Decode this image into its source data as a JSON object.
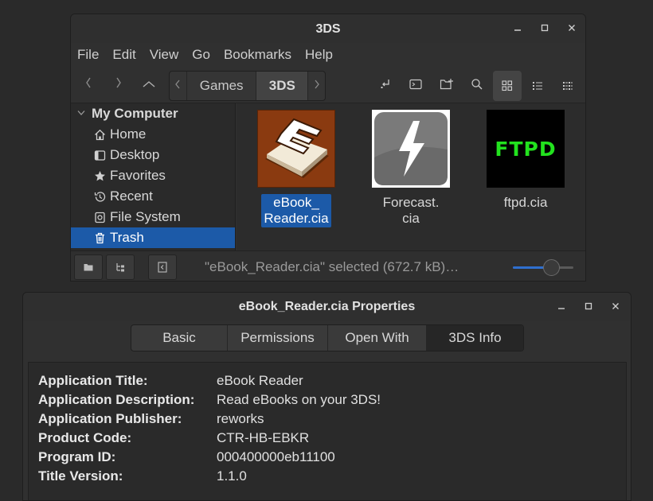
{
  "file_manager": {
    "title": "3DS",
    "menu": [
      "File",
      "Edit",
      "View",
      "Go",
      "Bookmarks",
      "Help"
    ],
    "path": [
      "Games",
      "3DS"
    ],
    "sidebar": {
      "header": "My Computer",
      "items": [
        {
          "label": "Home",
          "icon": "home-icon"
        },
        {
          "label": "Desktop",
          "icon": "desktop-icon"
        },
        {
          "label": "Favorites",
          "icon": "star-icon"
        },
        {
          "label": "Recent",
          "icon": "recent-icon"
        },
        {
          "label": "File System",
          "icon": "drive-icon"
        },
        {
          "label": "Trash",
          "icon": "trash-icon",
          "selected": true
        }
      ]
    },
    "files": [
      {
        "name_line1": "eBook_",
        "name_line2": "Reader.cia",
        "selected": true,
        "icon": "ebook-reader-app-icon"
      },
      {
        "name_line1": "Forecast.",
        "name_line2": "cia",
        "selected": false,
        "icon": "forecast-app-icon"
      },
      {
        "name_line1": "ftpd.cia",
        "name_line2": "",
        "selected": false,
        "icon": "ftpd-app-icon",
        "icon_text": "FTPD"
      }
    ],
    "status": "\"eBook_Reader.cia\" selected (672.7 kB)…",
    "zoom_fraction": 0.63
  },
  "properties": {
    "title": "eBook_Reader.cia Properties",
    "tabs": [
      "Basic",
      "Permissions",
      "Open With",
      "3DS Info"
    ],
    "active_tab": "3DS Info",
    "fields": [
      {
        "label": "Application Title:",
        "value": "eBook Reader"
      },
      {
        "label": "Application Description:",
        "value": "Read eBooks on your 3DS!"
      },
      {
        "label": "Application Publisher:",
        "value": "reworks"
      },
      {
        "label": "Product Code:",
        "value": "CTR-HB-EBKR"
      },
      {
        "label": "Program ID:",
        "value": "000400000eb11100"
      },
      {
        "label": "Title Version:",
        "value": "1.1.0"
      }
    ]
  },
  "colors": {
    "selection": "#1c5aa8",
    "window_bg": "#303030",
    "desktop_bg": "#2a2a2a"
  }
}
